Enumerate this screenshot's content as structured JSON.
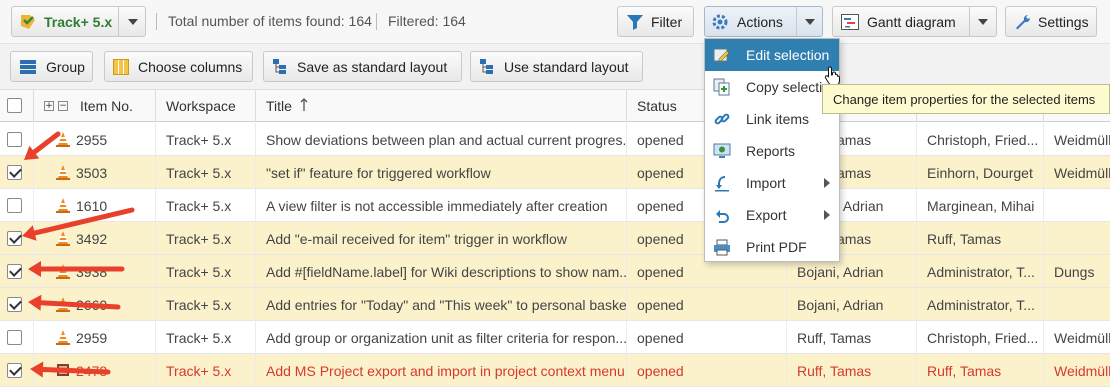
{
  "toolbar": {
    "project_label": "Track+ 5.x",
    "total_text": "Total number of items found: 164",
    "filtered_text": "Filtered: 164",
    "filter_label": "Filter",
    "actions_label": "Actions",
    "gantt_label": "Gantt diagram",
    "settings_label": "Settings"
  },
  "toolbar2": {
    "group_label": "Group",
    "choose_columns_label": "Choose columns",
    "save_layout_label": "Save as standard layout",
    "use_layout_label": "Use standard layout"
  },
  "grid": {
    "columns": [
      "Item No.",
      "Workspace",
      "Title",
      "Status"
    ],
    "rows": [
      {
        "id": "2955",
        "workspace": "Track+ 5.x",
        "title": "Show deviations between plan and actual current progres...",
        "status": "opened",
        "c5": "Ruff, Tamas",
        "c6": "Christoph, Fried...",
        "c7": "Weidmülle",
        "checked": false,
        "highlight": false,
        "red": false
      },
      {
        "id": "3503",
        "workspace": "Track+ 5.x",
        "title": "\"set if\" feature for triggered workflow",
        "status": "opened",
        "c5": "Ruff, Tamas",
        "c6": "Einhorn, Dourget",
        "c7": "Weidmülle",
        "checked": true,
        "highlight": true,
        "red": false
      },
      {
        "id": "1610",
        "workspace": "Track+ 5.x",
        "title": "A view filter is not accessible immediately after creation",
        "status": "opened",
        "c5": "Bojani, Adrian",
        "c6": "Marginean, Mihai",
        "c7": "",
        "checked": false,
        "highlight": false,
        "red": false
      },
      {
        "id": "3492",
        "workspace": "Track+ 5.x",
        "title": "Add \"e-mail received for item\" trigger in workflow",
        "status": "opened",
        "c5": "Ruff, Tamas",
        "c6": "Ruff, Tamas",
        "c7": "",
        "checked": true,
        "highlight": true,
        "red": false
      },
      {
        "id": "3938",
        "workspace": "Track+ 5.x",
        "title": "Add #[fieldName.label] for Wiki descriptions to show nam...",
        "status": "opened",
        "c5": "Bojani, Adrian",
        "c6": "Administrator, T...",
        "c7": "Dungs",
        "checked": true,
        "highlight": true,
        "red": false
      },
      {
        "id": "2660",
        "workspace": "Track+ 5.x",
        "title": "Add entries for \"Today\" and \"This week\" to personal baskets",
        "status": "opened",
        "c5": "Bojani, Adrian",
        "c6": "Administrator, T...",
        "c7": "",
        "checked": true,
        "highlight": true,
        "red": false
      },
      {
        "id": "2959",
        "workspace": "Track+ 5.x",
        "title": "Add group or organization unit as filter criteria for respon...",
        "status": "opened",
        "c5": "Ruff, Tamas",
        "c6": "Christoph, Fried...",
        "c7": "Weidmülle",
        "checked": false,
        "highlight": false,
        "red": false
      },
      {
        "id": "2478",
        "workspace": "Track+ 5.x",
        "title": "Add MS Project export and import in project context menu",
        "status": "opened",
        "c5": "Ruff, Tamas",
        "c6": "Ruff, Tamas",
        "c7": "Weidmülle",
        "checked": true,
        "highlight": true,
        "red": true
      }
    ]
  },
  "menu": {
    "items": [
      {
        "label": "Edit selection",
        "icon": "edit-selection-icon",
        "active": true,
        "submenu": false
      },
      {
        "label": "Copy selection",
        "icon": "copy-selection-icon",
        "active": false,
        "submenu": false
      },
      {
        "label": "Link items",
        "icon": "link-icon",
        "active": false,
        "submenu": false
      },
      {
        "label": "Reports",
        "icon": "reports-icon",
        "active": false,
        "submenu": false
      },
      {
        "label": "Import",
        "icon": "import-icon",
        "active": false,
        "submenu": true
      },
      {
        "label": "Export",
        "icon": "export-icon",
        "active": false,
        "submenu": true
      },
      {
        "label": "Print PDF",
        "icon": "print-icon",
        "active": false,
        "submenu": false
      }
    ]
  },
  "tooltip": {
    "text": "Change item properties for the selected items"
  },
  "colors": {
    "accent": "#2f7fb0",
    "highlight_row": "#fbf2cc",
    "red_text": "#d6382d",
    "project_green": "#2e7d32",
    "annotation_arrow": "#e8402a"
  }
}
